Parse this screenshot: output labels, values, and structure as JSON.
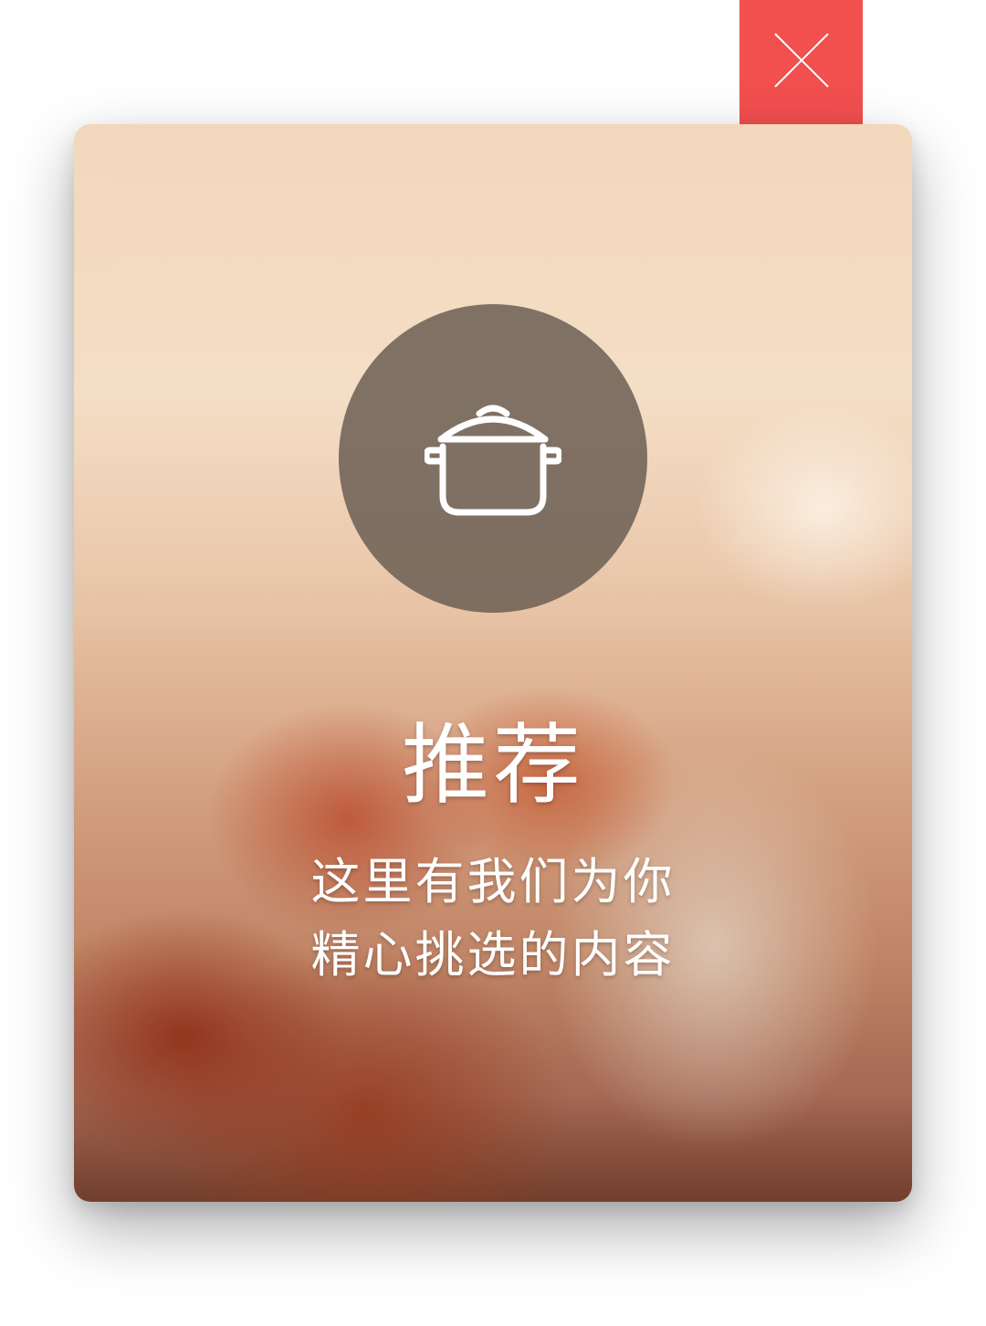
{
  "close_button": {
    "icon": "close-icon",
    "color": "#f24f4f"
  },
  "card": {
    "icon": "cooking-pot-icon",
    "title": "推荐",
    "subtitle_lines": [
      "这里有我们为你",
      "精心挑选的内容"
    ]
  }
}
